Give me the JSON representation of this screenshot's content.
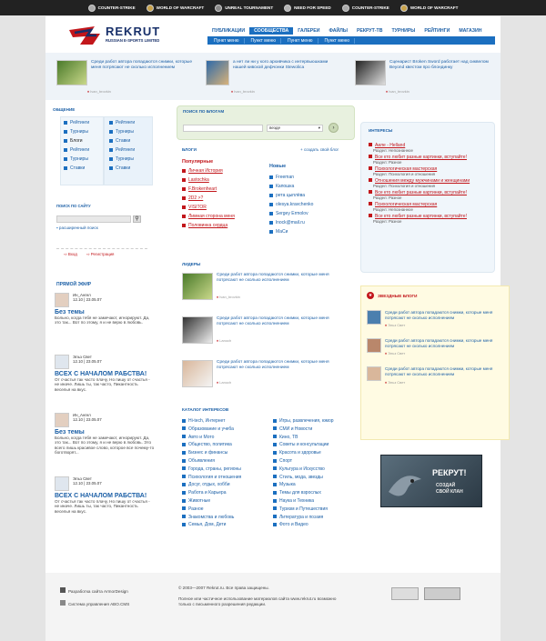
{
  "topbar": [
    {
      "label": "COUNTER-STRIKE",
      "color": "#aaaaaa"
    },
    {
      "label": "WORLD OF WARCRAFT",
      "color": "#c8a24a"
    },
    {
      "label": "UNREAL TOURNAMENT",
      "color": "#8a8a8a"
    },
    {
      "label": "NEED FOR SPEED",
      "color": "#b3b3b3"
    },
    {
      "label": "COUNTER-STRIKE",
      "color": "#aaaaaa"
    },
    {
      "label": "WORLD OF WARCRAFT",
      "color": "#c8a24a"
    }
  ],
  "logo": {
    "name": "REKRUT",
    "sub": "RUSSIAN E-SPORTS LIMITED"
  },
  "nav": [
    "ПУБЛИКАЦИИ",
    "СООБЩЕСТВА",
    "ГАЛЕРЕИ",
    "ФАЙЛЫ",
    "РЕКРУТ-ТВ",
    "ТУРНИРЫ",
    "РЕЙТИНГИ",
    "МАГАЗИН"
  ],
  "subnav": [
    "Пункт меню",
    "Пункт меню",
    "Пункт меню",
    "Пункт меню"
  ],
  "featured": [
    {
      "text": "Среди работ автора попадаются снимки, которые меня потрясают не сколько исполнением",
      "author": "Ivan_brovkin"
    },
    {
      "text": "а нет ли ни у кого архивчика с интервьюшками нашей кивской дефчонки Stewolica",
      "author": "Ivan_brovkin"
    },
    {
      "text": "Сценарист Broken Sword работает над сиквелом Beyond квестом про блондинку",
      "author": "Ivan_brovkin"
    }
  ],
  "obshenie": {
    "title": "ОБЩЕНИЕ",
    "col1": [
      "Рейтинги",
      "Турниры",
      "Блоги",
      "Рейтинги",
      "Турниры",
      "Ставки"
    ],
    "col2": [
      "Рейтинги",
      "Турниры",
      "Ставки",
      "Рейтинги",
      "Турниры",
      "Ставки"
    ]
  },
  "search_site": {
    "title": "ПОИСК ПО САЙТУ",
    "advanced": "расширенный поиск",
    "login": "Вход",
    "register": "Регистрация"
  },
  "live": {
    "title": "ПРЯМОЙ ЭФИР",
    "items": [
      {
        "name": "Ин_Ангел",
        "date": "12.10 | 23.05.07",
        "title": "Без темы",
        "text": "Больно, когда тебя не замечают, игнорируют. Да, это так... Вот по этому, я и не верю в любовь."
      },
      {
        "name": "Эльз Свет",
        "date": "12.10 | 23.05.07",
        "title": "ВСЕХ С НАЧАЛОМ РАБСТВА!",
        "text": "От счастья так часто плачу, Но пишу от счастья - не иначе. Лишь ты, так часто, Пикантность веселья на вкус."
      },
      {
        "name": "Ин_Ангел",
        "date": "12.10 | 23.05.07",
        "title": "Без темы",
        "text": "Больно, когда тебя не замечают, игнорируют. Да, это так... Вот по этому, я и не верю в любовь. Это всего лишь красивое слово, которое все почему-то боготворят..."
      },
      {
        "name": "Эльз Свет",
        "date": "12.10 | 23.05.07",
        "title": "ВСЕХ С НАЧАЛОМ РАБСТВА!",
        "text": "От счастья так часто плачу, Но пишу от счастья - не иначе. Лишь ты, так часто, Пикантность веселья на вкус."
      }
    ]
  },
  "blog_search": {
    "title": "ПОИСК ПО БЛОГАМ",
    "select": "везде"
  },
  "blogs": {
    "title": "БЛОГИ",
    "create": "+ создать свой блог",
    "popular_title": "Популярные",
    "popular": [
      "Личная История",
      "Lastochka",
      "F.Brokenheart",
      "2D2 >?",
      "VISITOR",
      "Лимная сторона меня",
      "Половинка сердца"
    ],
    "new_title": "Новые",
    "new": [
      "Freeman",
      "Капошка",
      "рета цыплёва",
      "olesya.kravchenko",
      "Sergey Ermolov",
      "lnock@mail.ru",
      "МаСи"
    ]
  },
  "leaders": {
    "title": "ЛИДЕРЫ",
    "items": [
      {
        "text": "Среди работ автора попадаются снимки, которые меня потрясают не сколько исполнением",
        "author": "Ivan_brovkin"
      },
      {
        "text": "Среди работ автора попадаются снимки, которые меня потрясают не сколько исполнением",
        "author": "Lanoch"
      },
      {
        "text": "Среди работ автора попадаются снимки, которые меня потрясают не сколько исполнением",
        "author": "Lanoch"
      }
    ]
  },
  "catalog": {
    "title": "КАТАЛОГ ИНТЕРЕСОВ",
    "col1": [
      "Hi-tech, Интернет",
      "Образование и учеба",
      "Авто и Мото",
      "Общество, политика",
      "Бизнес и финансы",
      "Объявления",
      "Города, страны, регионы",
      "Психология и отношения",
      "Досуг, отдых, хобби",
      "Работа и Карьера",
      "Животные",
      "Разное",
      "Знакомства и любовь",
      "Семья, Дом, Дети"
    ],
    "col2": [
      "Игры, развлечения, юмор",
      "СМИ и Новости",
      "Кино, ТВ",
      "Советы и консультации",
      "Красота и здоровье",
      "Спорт",
      "Культура и Искусство",
      "Стиль, мода, звезды",
      "Музыка",
      "Темы для взрослых",
      "Наука и Техника",
      "Туризм и Путешествия",
      "Литература и поэзия",
      "Фото и Видео"
    ]
  },
  "interests": {
    "title": "ИНТЕРЕСЫ",
    "items": [
      {
        "link": "Аиле - Helland",
        "sub": "Раздел: Непознанное"
      },
      {
        "link": "Все кто любит разные картинки, вступайте!",
        "sub": "Раздел: Разное"
      },
      {
        "link": "Психологическая мастерская",
        "sub": "Раздел: Психология и отношения"
      },
      {
        "link": "Отношения между мужчинами и женщинами",
        "sub": "Раздел: Психология и отношения"
      },
      {
        "link": "Все кто любит разные картинки, вступайте!",
        "sub": "Раздел: Разное"
      },
      {
        "link": "Психологическая мастерская",
        "sub": "Раздел: Непознанное"
      },
      {
        "link": "Все кто любит разные картинки, вступайте!",
        "sub": "Раздел: Разное"
      }
    ]
  },
  "star_blogs": {
    "title": "ЗВЕЗДНЫЕ БЛОГИ",
    "items": [
      {
        "text": "Среди работ автора попадаются снимки, которые меня потрясают не сколько исполнением",
        "author": "Эльз Свет"
      },
      {
        "text": "Среди работ автора попадаются снимки, которые меня потрясают не сколько исполнением",
        "author": "Эльз Свет"
      },
      {
        "text": "Среди работ автора попадаются снимки, которые меня потрясают не сколько исполнением",
        "author": "Эльз Свет"
      }
    ]
  },
  "banner": {
    "line1": "РЕКРУТ!",
    "line2": "СОЗДАЙ",
    "line3": "СВОЙ КЛАН"
  },
  "footer": {
    "dev": "Разработка сайта ArmorDesign",
    "cms": "Система управления ABO.CMS",
    "copy": "© 2003—2007 Rekrut.ru. Все права защищены.",
    "note": "Полное или частичное использование материалов сайта www.rekrut.ru возможно только с письменного разрешения редакции."
  }
}
